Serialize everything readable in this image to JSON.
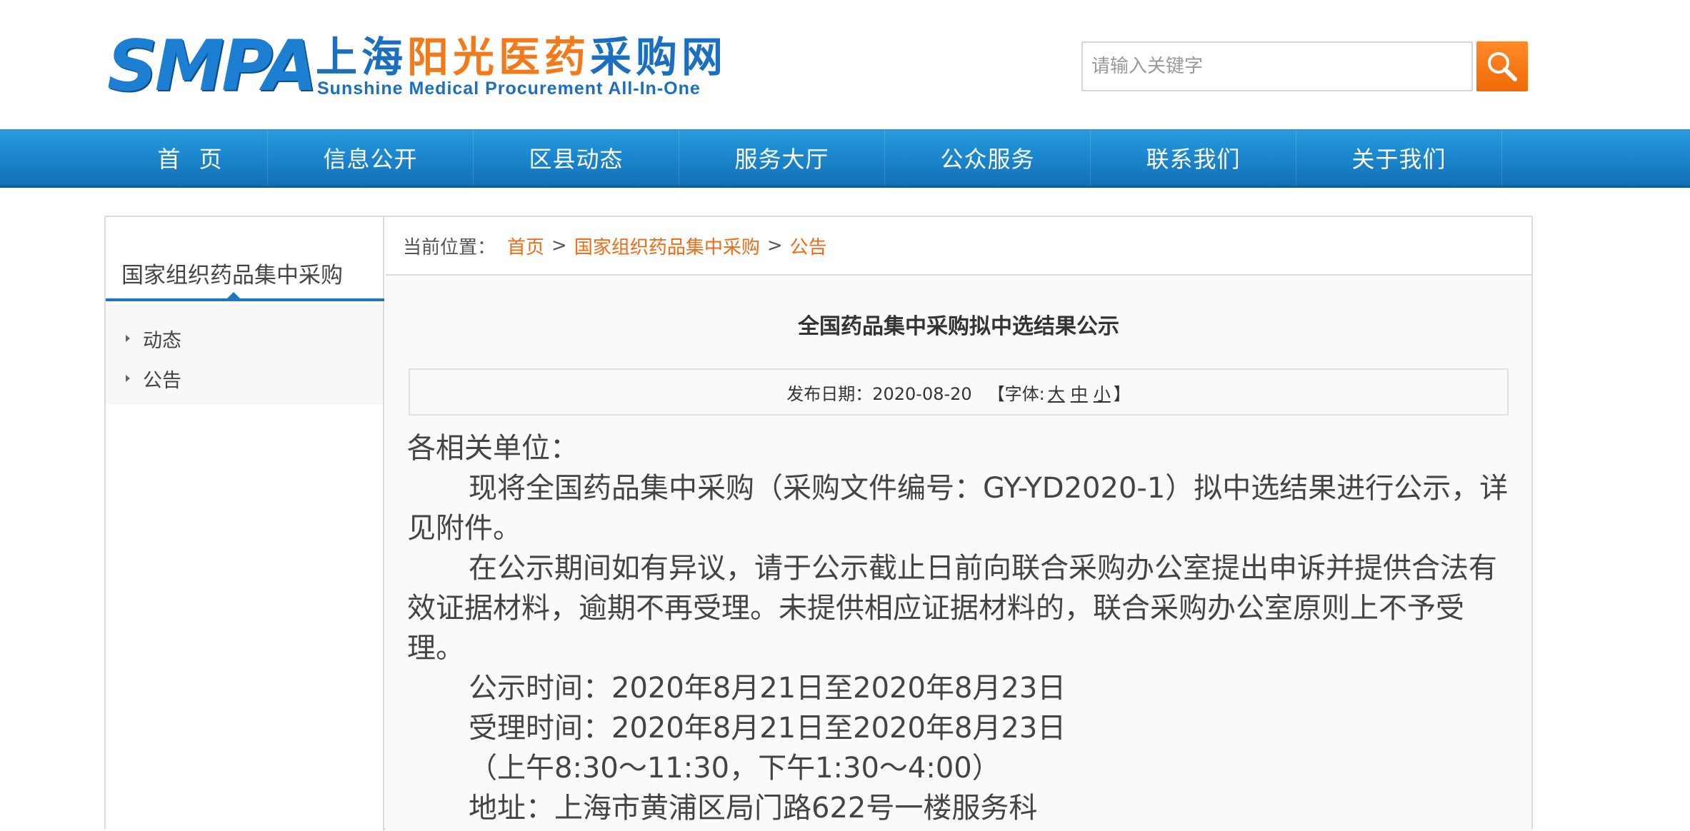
{
  "header": {
    "logo": {
      "abbr": "SMPA",
      "name_part1": "上海",
      "name_part2": "阳光",
      "name_part3": "医药",
      "name_part4": "采购网",
      "english": "Sunshine Medical Procurement All-In-One"
    },
    "search": {
      "placeholder": "请输入关键字",
      "value": "",
      "icon": "search-icon"
    }
  },
  "nav": {
    "items": [
      {
        "label": "首 页"
      },
      {
        "label": "信息公开"
      },
      {
        "label": "区县动态"
      },
      {
        "label": "服务大厅"
      },
      {
        "label": "公众服务"
      },
      {
        "label": "联系我们"
      },
      {
        "label": "关于我们"
      }
    ]
  },
  "sidebar": {
    "title": "国家组织药品集中采购",
    "items": [
      {
        "label": "动态"
      },
      {
        "label": "公告"
      }
    ]
  },
  "breadcrumb": {
    "prefix": "当前位置：",
    "items": [
      {
        "label": "首页"
      },
      {
        "label": "国家组织药品集中采购"
      },
      {
        "label": "公告"
      }
    ],
    "separator": ">"
  },
  "article": {
    "title": "全国药品集中采购拟中选结果公示",
    "meta": {
      "date_label": "发布日期：2020-08-20",
      "font_prefix": "【字体:",
      "font_large": "大",
      "font_medium": "中",
      "font_small": "小",
      "font_suffix": "】"
    },
    "paragraphs": [
      {
        "text": "各相关单位：",
        "indent": false
      },
      {
        "text": "现将全国药品集中采购（采购文件编号：GY-YD2020-1）拟中选结果进行公示，详见附件。",
        "indent": true
      },
      {
        "text": "在公示期间如有异议，请于公示截止日前向联合采购办公室提出申诉并提供合法有效证据材料，逾期不再受理。未提供相应证据材料的，联合采购办公室原则上不予受理。",
        "indent": true
      },
      {
        "text": "公示时间：2020年8月21日至2020年8月23日",
        "indent": true
      },
      {
        "text": "受理时间：2020年8月21日至2020年8月23日",
        "indent": true
      },
      {
        "text": "（上午8:30～11:30，下午1:30～4:00）",
        "indent": true
      },
      {
        "text": "地址：上海市黄浦区局门路622号一楼服务科",
        "indent": true
      }
    ]
  },
  "colors": {
    "nav_blue": "#1b86cd",
    "accent_orange": "#f06a14",
    "logo_blue": "#1a6fc0",
    "logo_orange": "#f27a1b"
  }
}
